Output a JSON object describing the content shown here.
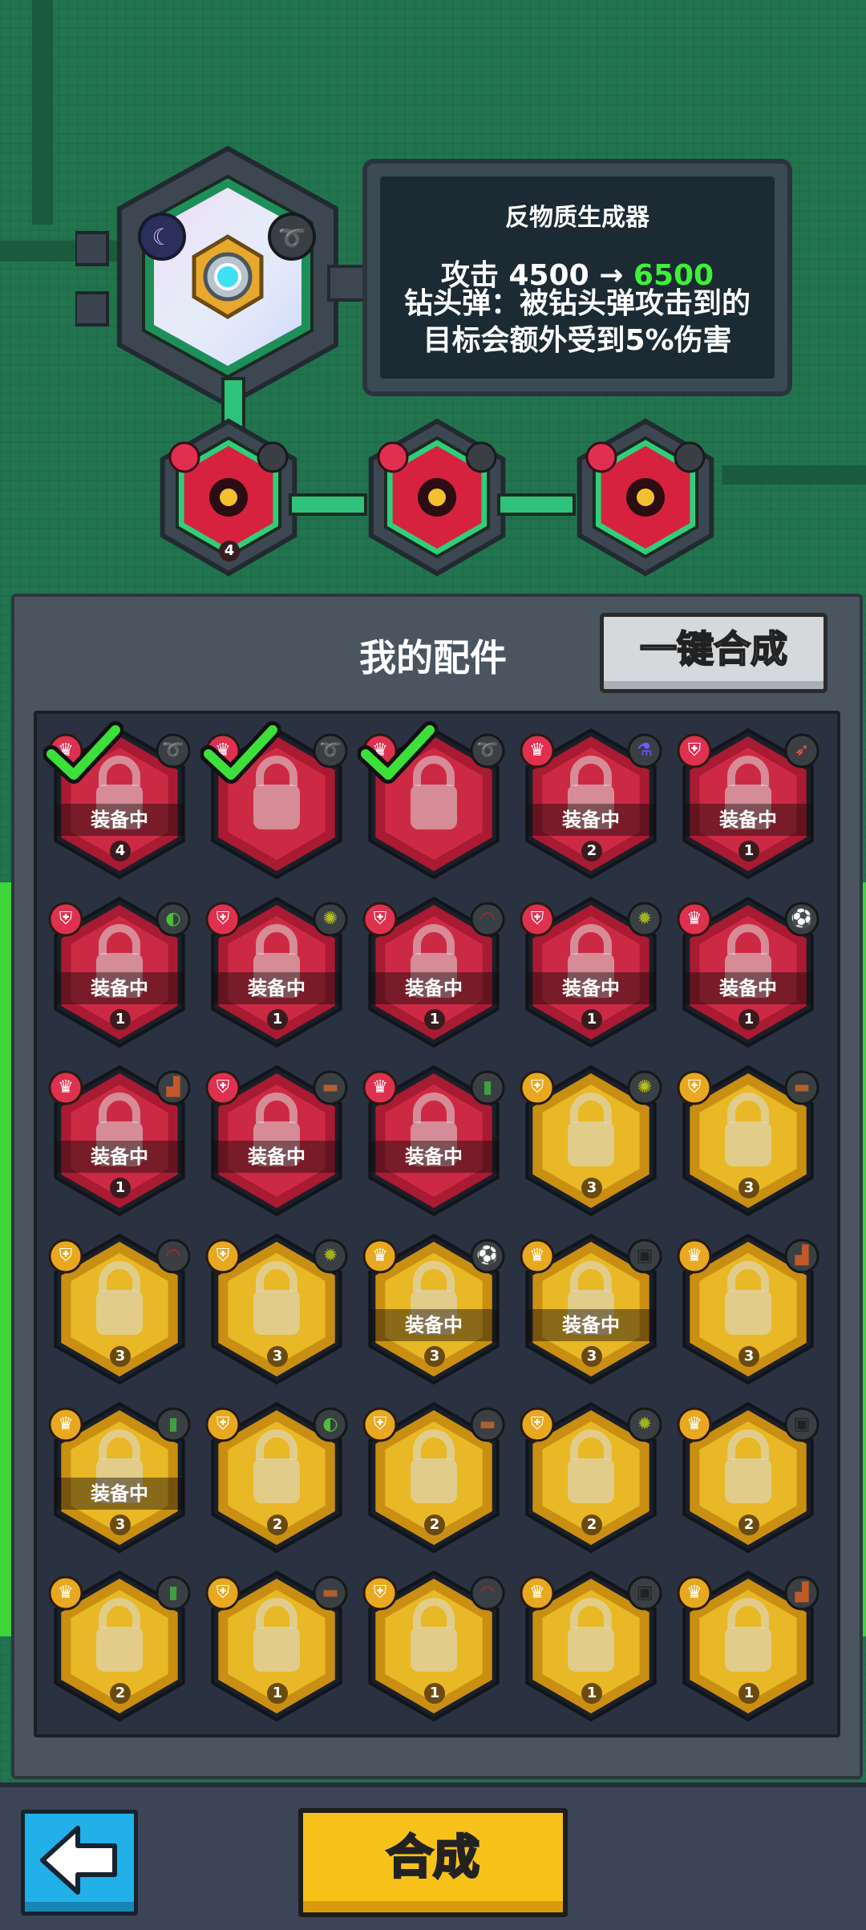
{
  "device": {
    "name": "反物质生成器",
    "attack_label": "攻击",
    "attack_current": "4500",
    "arrow": "→",
    "attack_new": "6500",
    "effect_text": "钻头弹：被钻头弹攻击到的目标会额外受到5%伤害"
  },
  "slots": [
    {
      "level": "4"
    },
    {
      "level": ""
    },
    {
      "level": ""
    }
  ],
  "panel": {
    "title": "我的配件",
    "merge_all_label": "一键合成"
  },
  "equipped_label": "装备中",
  "parts": [
    {
      "color": "red",
      "badge": "crown",
      "icon": "drill-icon",
      "checked": true,
      "equipped": true,
      "level": "4"
    },
    {
      "color": "red",
      "badge": "crown",
      "icon": "drill-icon",
      "checked": true,
      "equipped": false,
      "level": ""
    },
    {
      "color": "red",
      "badge": "crown",
      "icon": "drill-icon",
      "checked": true,
      "equipped": false,
      "level": ""
    },
    {
      "color": "red",
      "badge": "crown",
      "icon": "potion-icon",
      "checked": false,
      "equipped": true,
      "level": "2"
    },
    {
      "color": "red",
      "badge": "shield",
      "icon": "rocket-icon",
      "checked": false,
      "equipped": true,
      "level": "1"
    },
    {
      "color": "red",
      "badge": "shield",
      "icon": "watermelon-icon",
      "checked": false,
      "equipped": true,
      "level": "1"
    },
    {
      "color": "red",
      "badge": "shield",
      "icon": "durian-icon",
      "checked": false,
      "equipped": true,
      "level": "1"
    },
    {
      "color": "red",
      "badge": "shield",
      "icon": "boomerang-icon",
      "checked": false,
      "equipped": true,
      "level": "1"
    },
    {
      "color": "red",
      "badge": "shield",
      "icon": "spiky-ball-icon",
      "checked": false,
      "equipped": true,
      "level": "1"
    },
    {
      "color": "red",
      "badge": "crown",
      "icon": "soccer-ball-icon",
      "checked": false,
      "equipped": true,
      "level": "1"
    },
    {
      "color": "red",
      "badge": "crown",
      "icon": "boot-icon",
      "checked": false,
      "equipped": true,
      "level": "1"
    },
    {
      "color": "red",
      "badge": "shield",
      "icon": "brick-icon",
      "checked": false,
      "equipped": true,
      "level": ""
    },
    {
      "color": "red",
      "badge": "crown",
      "icon": "bottle-icon",
      "checked": false,
      "equipped": true,
      "level": ""
    },
    {
      "color": "yellow",
      "badge": "shield",
      "icon": "durian-icon",
      "checked": false,
      "equipped": false,
      "level": "3"
    },
    {
      "color": "yellow",
      "badge": "shield",
      "icon": "brick-icon",
      "checked": false,
      "equipped": false,
      "level": "3"
    },
    {
      "color": "yellow",
      "badge": "shield",
      "icon": "boomerang-icon",
      "checked": false,
      "equipped": false,
      "level": "3"
    },
    {
      "color": "yellow",
      "badge": "shield",
      "icon": "spiky-ball-icon",
      "checked": false,
      "equipped": false,
      "level": "3"
    },
    {
      "color": "yellow",
      "badge": "crown",
      "icon": "soccer-ball-icon",
      "checked": false,
      "equipped": true,
      "level": "3"
    },
    {
      "color": "yellow",
      "badge": "crown",
      "icon": "cannon-icon",
      "checked": false,
      "equipped": true,
      "level": "3"
    },
    {
      "color": "yellow",
      "badge": "crown",
      "icon": "boot-icon",
      "checked": false,
      "equipped": false,
      "level": "3"
    },
    {
      "color": "yellow",
      "badge": "crown",
      "icon": "bottle-icon",
      "checked": false,
      "equipped": true,
      "level": "3"
    },
    {
      "color": "yellow",
      "badge": "shield",
      "icon": "watermelon-icon",
      "checked": false,
      "equipped": false,
      "level": "2"
    },
    {
      "color": "yellow",
      "badge": "shield",
      "icon": "brick-icon",
      "checked": false,
      "equipped": false,
      "level": "2"
    },
    {
      "color": "yellow",
      "badge": "shield",
      "icon": "spiky-ball-icon",
      "checked": false,
      "equipped": false,
      "level": "2"
    },
    {
      "color": "yellow",
      "badge": "crown",
      "icon": "cannon-icon",
      "checked": false,
      "equipped": false,
      "level": "2"
    },
    {
      "color": "yellow",
      "badge": "crown",
      "icon": "bottle-icon",
      "checked": false,
      "equipped": false,
      "level": "2"
    },
    {
      "color": "yellow",
      "badge": "shield",
      "icon": "brick-icon",
      "checked": false,
      "equipped": false,
      "level": "1"
    },
    {
      "color": "yellow",
      "badge": "shield",
      "icon": "boomerang-icon",
      "checked": false,
      "equipped": false,
      "level": "1"
    },
    {
      "color": "yellow",
      "badge": "crown",
      "icon": "cannon-icon",
      "checked": false,
      "equipped": false,
      "level": "1"
    },
    {
      "color": "yellow",
      "badge": "crown",
      "icon": "boot-icon",
      "checked": false,
      "equipped": false,
      "level": "1"
    }
  ],
  "buttons": {
    "back_icon": "back-arrow-icon",
    "synthesize_label": "合成"
  },
  "colors": {
    "background": "#22744f",
    "accent_green": "#3ff03a",
    "rare_red": "#c9213f",
    "common_yellow": "#e2b326",
    "synth_button": "#f6c219",
    "back_button": "#22b0e8"
  }
}
